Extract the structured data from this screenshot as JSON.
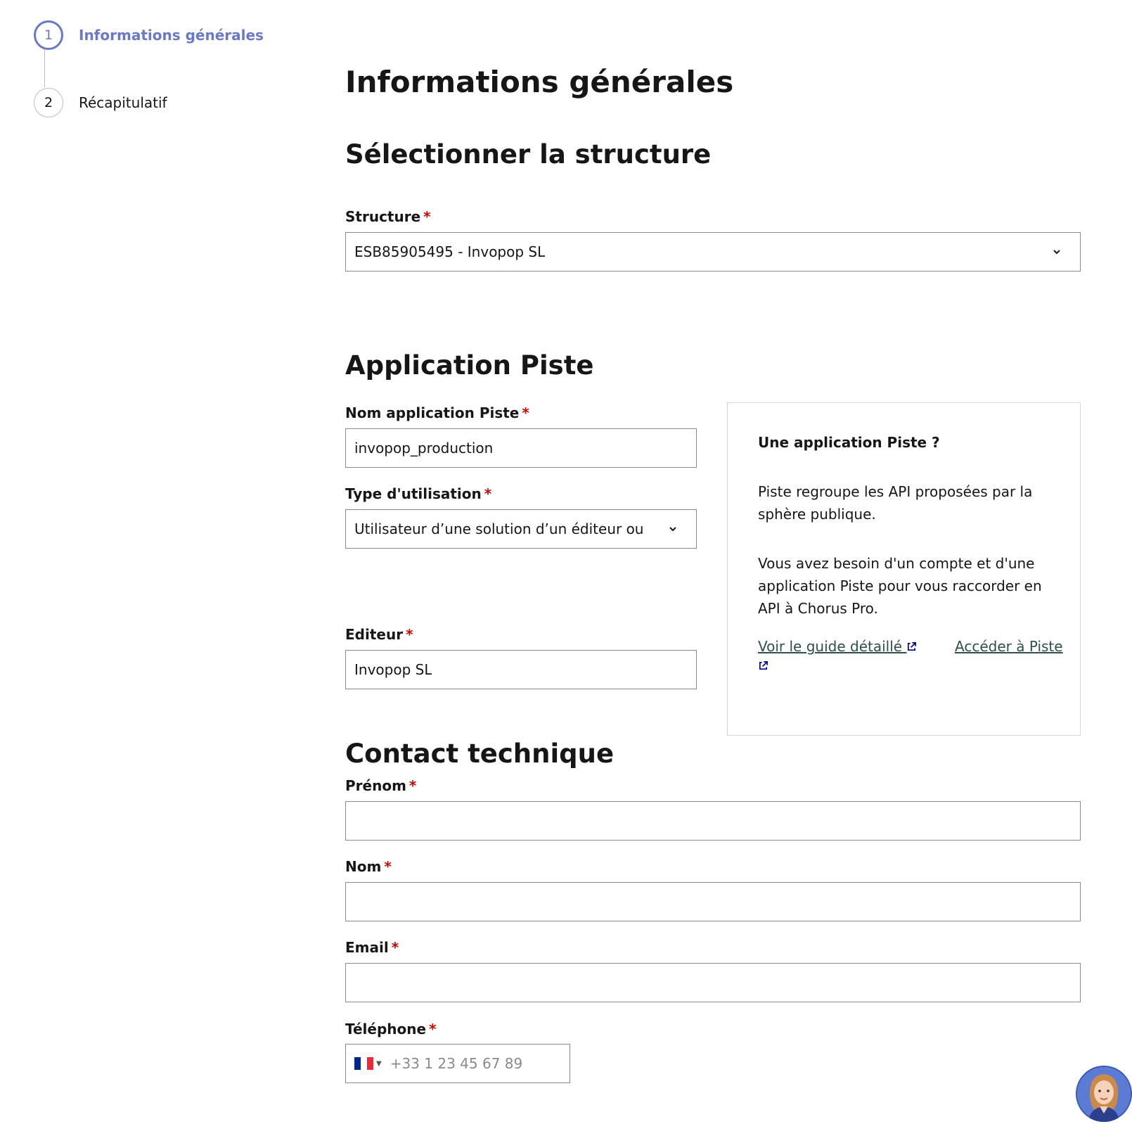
{
  "stepper": {
    "steps": [
      {
        "number": "1",
        "label": "Informations générales",
        "state": "active"
      },
      {
        "number": "2",
        "label": "Récapitulatif",
        "state": "inactive"
      }
    ]
  },
  "page": {
    "title": "Informations générales",
    "required_mark": "*"
  },
  "structure_section": {
    "heading": "Sélectionner la structure",
    "structure_label": "Structure",
    "structure_value": "ESB85905495 - Invopop SL"
  },
  "piste_section": {
    "heading": "Application Piste",
    "app_name_label": "Nom application Piste",
    "app_name_value": "invopop_production",
    "usage_type_label": "Type d'utilisation",
    "usage_type_value": "Utilisateur d’une solution d’un éditeur ou",
    "editor_label": "Editeur",
    "editor_value": "Invopop SL",
    "info": {
      "title": "Une application Piste ?",
      "paragraph_1": "Piste regroupe les API proposées par la sphère publique.",
      "paragraph_2": "Vous avez besoin d'un compte et d'une application Piste pour vous raccorder en API à Chorus Pro.",
      "link_guide": "Voir le guide détaillé",
      "link_piste": "Accéder à Piste"
    }
  },
  "contact_section": {
    "heading": "Contact technique",
    "firstname_label": "Prénom",
    "firstname_value": "",
    "lastname_label": "Nom",
    "lastname_value": "",
    "email_label": "Email",
    "email_value": "",
    "phone_label": "Téléphone",
    "phone_placeholder": "+33 1 23 45 67 89",
    "phone_country_flag": "france-flag-icon"
  },
  "colors": {
    "accent": "#6a78c8",
    "required": "#ce0500",
    "link": "#2f4f4f",
    "flag_blue": "#002395",
    "flag_white": "#ffffff",
    "flag_red": "#ed2939"
  }
}
